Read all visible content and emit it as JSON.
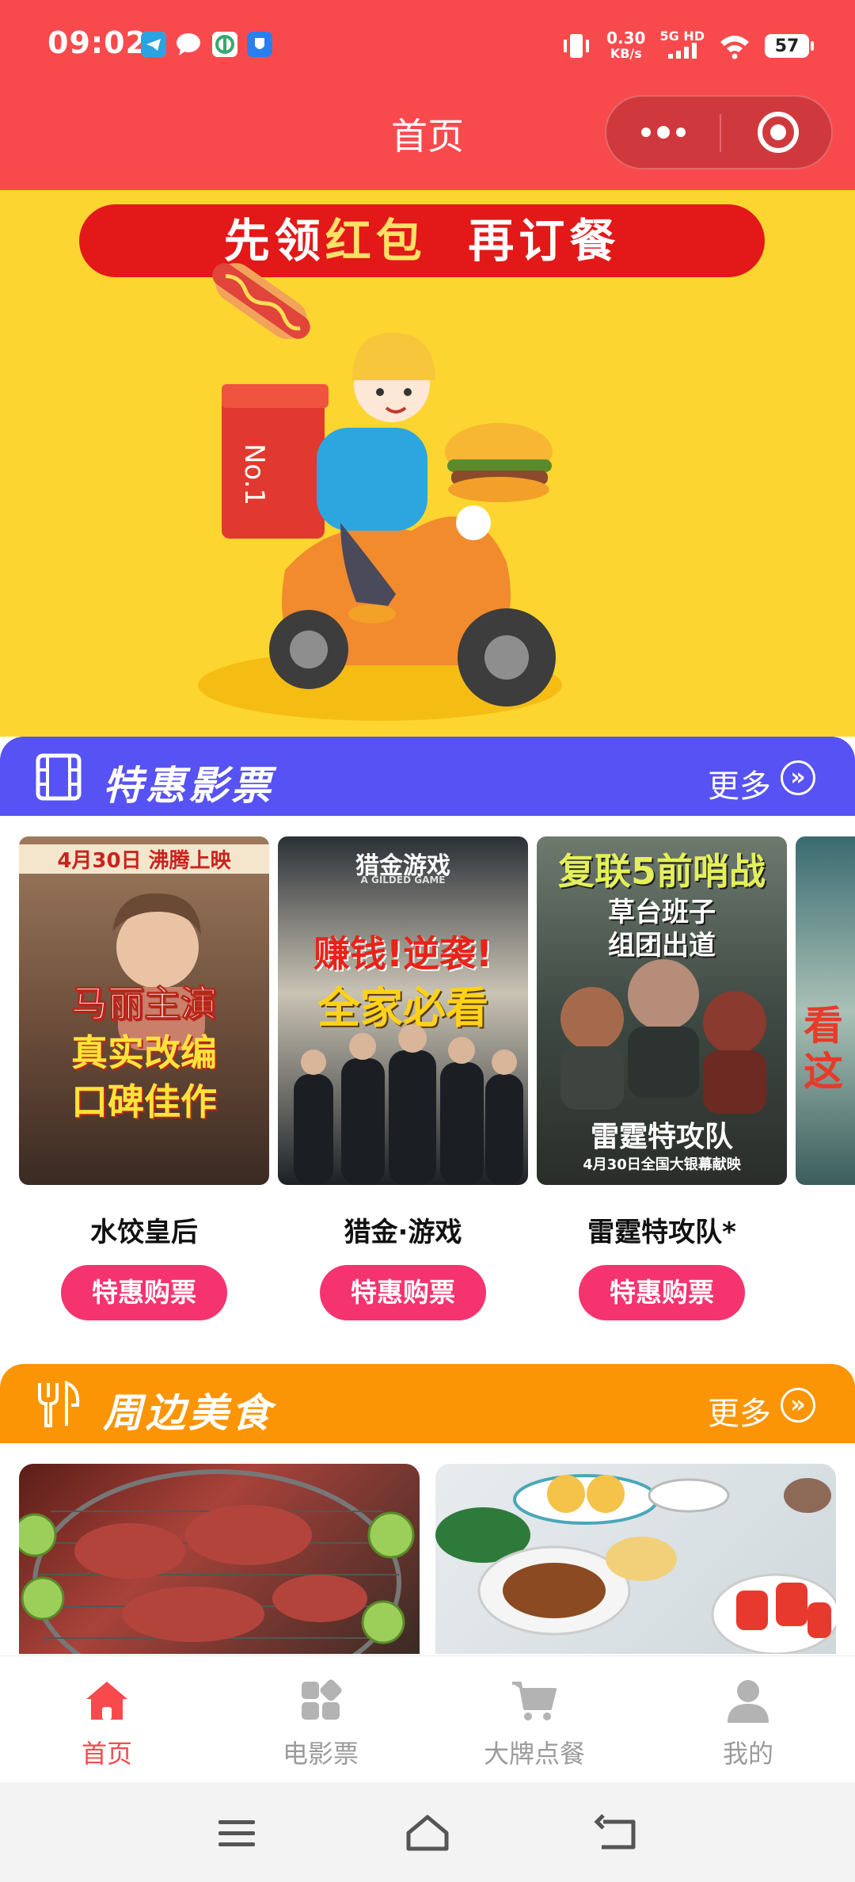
{
  "status_bar": {
    "time": "09:02",
    "net_speed_top": "0.30",
    "net_speed_bottom": "KB/s",
    "net_type": "5G HD",
    "battery": "57"
  },
  "header": {
    "title": "首页"
  },
  "banner": {
    "text_part1": "先领",
    "text_highlight": "红包",
    "text_part2": "再订餐"
  },
  "movies_section": {
    "title": "特惠影票",
    "more_label": "更多",
    "color": "#5752f3",
    "items": [
      {
        "name": "水饺皇后",
        "button": "特惠购票",
        "poster_top": "4月30日 沸腾上映",
        "poster_main": [
          "马丽主演",
          "真实改编",
          "口碑佳作"
        ]
      },
      {
        "name": "猎金·游戏",
        "button": "特惠购票",
        "poster_top": "猎金游戏",
        "poster_sub": "A GILDED GAME",
        "poster_main": [
          "赚钱!逆袭!",
          "全家必看"
        ]
      },
      {
        "name": "雷霆特攻队*",
        "button": "特惠购票",
        "poster_top": "复联5前哨战",
        "poster_main": [
          "草台班子",
          "组团出道"
        ],
        "poster_title": "雷霆特攻队",
        "poster_date": "4月30日全国大银幕献映"
      }
    ],
    "partial_poster_text": "看这"
  },
  "food_section": {
    "title": "周边美食",
    "more_label": "更多",
    "color": "#fb9505"
  },
  "tab_bar": {
    "items": [
      {
        "label": "首页",
        "icon": "home-icon",
        "active": true
      },
      {
        "label": "电影票",
        "icon": "grid-icon",
        "active": false
      },
      {
        "label": "大牌点餐",
        "icon": "cart-icon",
        "active": false
      },
      {
        "label": "我的",
        "icon": "user-icon",
        "active": false
      }
    ],
    "active_color": "#f84a4d",
    "inactive_color": "#9b9b9b"
  }
}
